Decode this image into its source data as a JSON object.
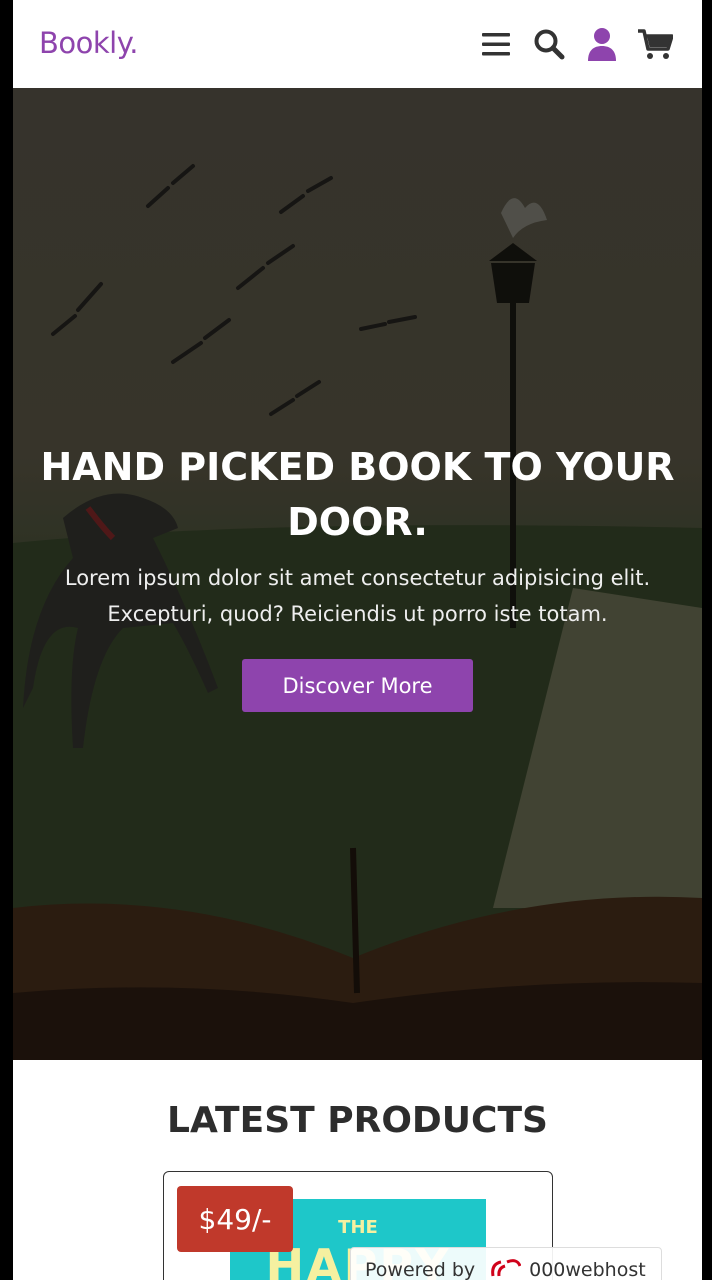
{
  "header": {
    "logo": "Bookly.",
    "icons": [
      "menu-icon",
      "search-icon",
      "user-icon",
      "cart-icon"
    ],
    "accent_color": "#8e44ad"
  },
  "hero": {
    "title": "HAND PICKED BOOK TO YOUR DOOR.",
    "text": "Lorem ipsum dolor sit amet consectetur adipisicing elit. Excepturi, quod? Reiciendis ut porro iste totam.",
    "button_label": "Discover More"
  },
  "products": {
    "title": "LATEST PRODUCTS",
    "items": [
      {
        "price": "$49/-",
        "cover_text_small": "THE",
        "cover_text_big": "HAPPY"
      }
    ]
  },
  "footer_badge": {
    "prefix": "Powered by",
    "host": "000webhost"
  }
}
